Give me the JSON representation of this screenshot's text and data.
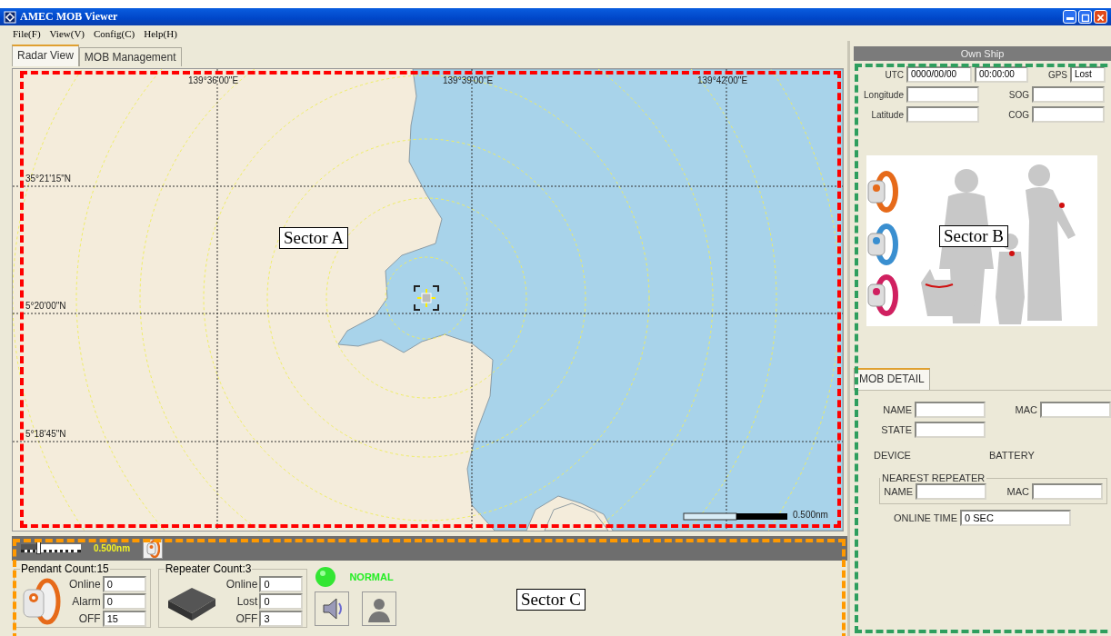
{
  "window": {
    "title": "AMEC MOB Viewer"
  },
  "menu": [
    {
      "label": "File(F)"
    },
    {
      "label": "View(V)"
    },
    {
      "label": "Config(C)"
    },
    {
      "label": "Help(H)"
    }
  ],
  "tabs": [
    {
      "label": "Radar View",
      "selected": true
    },
    {
      "label": "MOB Management",
      "selected": false
    }
  ],
  "map": {
    "longitude_labels": [
      "139°36'00\"E",
      "139°39'00\"E",
      "139°42'00\"E"
    ],
    "latitude_labels": [
      "35°21'15\"N",
      "5°20'00\"N",
      "5°18'45\"N"
    ],
    "scale_label": "0.500nm"
  },
  "range_bar": {
    "range_label": "0.500nm",
    "slider": {
      "level": 0.25
    }
  },
  "pendant_group": {
    "title": "Pendant Count:15",
    "fields": [
      {
        "label": "Online",
        "value": "0"
      },
      {
        "label": "Alarm",
        "value": "0"
      },
      {
        "label": "OFF",
        "value": "15"
      }
    ]
  },
  "repeater_group": {
    "title": "Repeater Count:3",
    "fields": [
      {
        "label": "Online",
        "value": "0"
      },
      {
        "label": "Lost",
        "value": "0"
      },
      {
        "label": "OFF",
        "value": "3"
      }
    ]
  },
  "status": {
    "label": "NORMAL"
  },
  "own_ship": {
    "title": "Own Ship",
    "utc_label": "UTC",
    "utc_date": "0000/00/00",
    "utc_time": "00:00:00",
    "gps_label": "GPS",
    "gps_value": "Lost",
    "fields": [
      {
        "label": "Longitude"
      },
      {
        "label": "SOG"
      },
      {
        "label": "Latitude"
      },
      {
        "label": "COG"
      }
    ]
  },
  "mob_detail": {
    "tabs": [
      {
        "label": "MOB DETAIL",
        "selected": true
      }
    ],
    "name_label": "NAME",
    "mac_label": "MAC",
    "state_label": "STATE",
    "device_label": "DEVICE",
    "battery_label": "BATTERY",
    "nearest_repeater": {
      "title": "NEAREST REPEATER",
      "name_label": "NAME",
      "mac_label": "MAC"
    },
    "online_time_label": "ONLINE TIME",
    "online_time_value": "0 SEC"
  },
  "annotations": [
    {
      "label": "Sector A",
      "color": "#ff0000"
    },
    {
      "label": "Sector B",
      "color": "#2e9e5e"
    },
    {
      "label": "Sector C",
      "color": "#ff9900"
    }
  ]
}
